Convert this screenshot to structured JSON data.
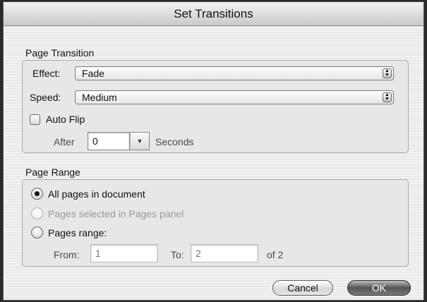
{
  "dialog": {
    "title": "Set Transitions"
  },
  "page_transition": {
    "section_label": "Page Transition",
    "effect_label": "Effect:",
    "effect_value": "Fade",
    "speed_label": "Speed:",
    "speed_value": "Medium",
    "auto_flip_label": "Auto Flip",
    "auto_flip_checked": false,
    "after_label": "After",
    "after_value": "0",
    "seconds_label": "Seconds"
  },
  "page_range": {
    "section_label": "Page Range",
    "options": [
      {
        "label": "All pages in document",
        "selected": true,
        "enabled": true
      },
      {
        "label": "Pages selected in Pages panel",
        "selected": false,
        "enabled": false
      },
      {
        "label": "Pages range:",
        "selected": false,
        "enabled": true
      }
    ],
    "from_label": "From:",
    "from_value": "1",
    "to_label": "To:",
    "to_value": "2",
    "of_label": "of 2"
  },
  "buttons": {
    "cancel": "Cancel",
    "ok": "OK"
  },
  "icons": {
    "popup_stepper": "up-down-arrows-icon",
    "combo_arrow": "triangle-down-icon"
  }
}
